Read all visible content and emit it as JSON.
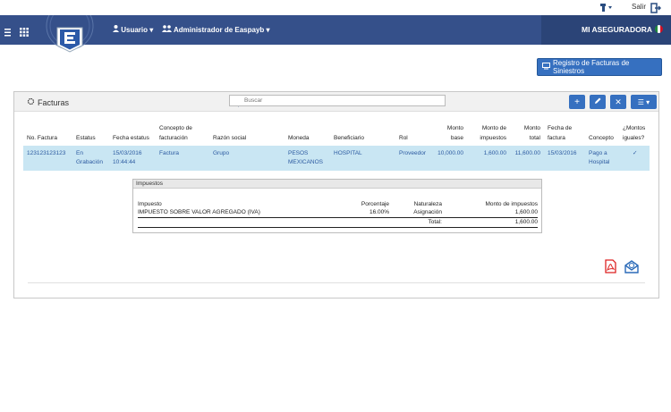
{
  "topbar": {
    "logout_label": "Salir"
  },
  "navbar": {
    "user_menu": "Usuario",
    "admin_menu": "Administrador de Easpayb",
    "insurer": "MI ASEGURADORA"
  },
  "actions": {
    "register_button": "Registro de Facturas de Siniestros"
  },
  "panel": {
    "title": "Facturas",
    "search_placeholder": "Buscar"
  },
  "table": {
    "headers": {
      "no_factura": "No. Factura",
      "estatus": "Estatus",
      "fecha_estatus": "Fecha estatus",
      "concepto_facturacion_1": "Concepto de",
      "concepto_facturacion_2": "facturación",
      "razon_social": "Razón social",
      "moneda": "Moneda",
      "beneficiario": "Beneficiario",
      "rol": "Rol",
      "monto_base_1": "Monto",
      "monto_base_2": "base",
      "monto_impuestos_1": "Monto de",
      "monto_impuestos_2": "impuestos",
      "monto_total_1": "Monto",
      "monto_total_2": "total",
      "fecha_factura_1": "Fecha de",
      "fecha_factura_2": "factura",
      "concepto": "Concepto",
      "montos_iguales_1": "¿Montos",
      "montos_iguales_2": "iguales?"
    },
    "row": {
      "no_factura": "123123123123",
      "estatus_1": "En",
      "estatus_2": "Grabación",
      "fecha_estatus_1": "15/03/2016",
      "fecha_estatus_2": "10:44:44",
      "concepto_facturacion": "Factura",
      "razon_social": "Grupo",
      "moneda_1": "PESOS",
      "moneda_2": "MEXICANOS",
      "beneficiario": "HOSPITAL",
      "rol": "Proveedor",
      "monto_base": "10,000.00",
      "monto_impuestos": "1,600.00",
      "monto_total": "11,600.00",
      "fecha_factura": "15/03/2016",
      "concepto_1": "Pago a",
      "concepto_2": "Hospital",
      "montos_iguales": "✓"
    }
  },
  "impuestos": {
    "title": "Impuestos",
    "headers": {
      "impuesto": "Impuesto",
      "porcentaje": "Porcentaje",
      "naturaleza": "Naturaleza",
      "monto": "Monto de impuestos"
    },
    "row": {
      "impuesto": "IMPUESTO SOBRE VALOR AGREGADO (IVA)",
      "porcentaje": "16.00%",
      "naturaleza": "Asignación",
      "monto": "1,600.00"
    },
    "total_label": "Total:",
    "total_value": "1,600.00"
  },
  "icons": [
    "menu-icon",
    "apps-icon",
    "user-icon",
    "users-icon",
    "flag-icon",
    "logout-icon",
    "monitor-icon",
    "search-icon",
    "plus-icon",
    "edit-icon",
    "close-icon",
    "list-icon",
    "pdf-icon",
    "mail-icon"
  ],
  "colors": {
    "navbar": "#35508a",
    "accent": "#3670c0",
    "selected_row": "#c9e6f3"
  }
}
